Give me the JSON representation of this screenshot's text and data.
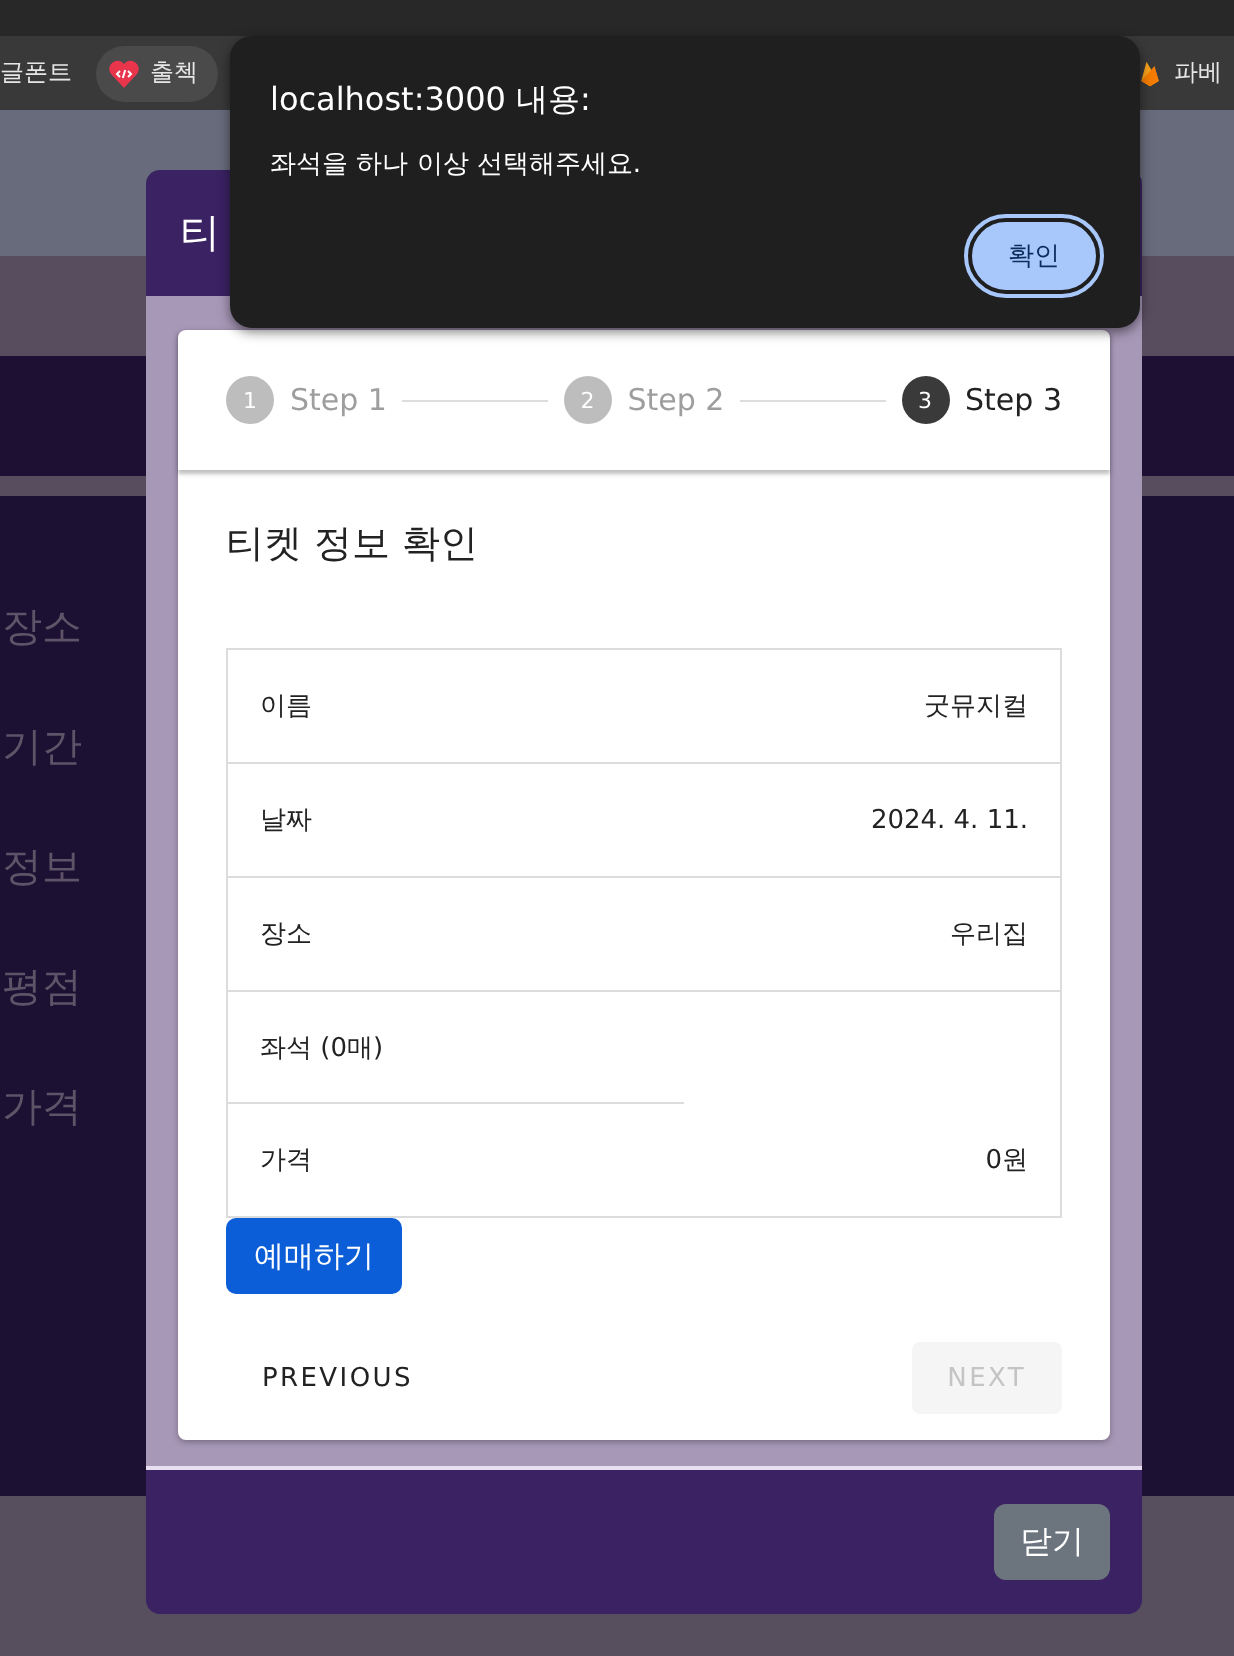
{
  "bookmarks": [
    {
      "label": "글폰트",
      "kind": "plain"
    },
    {
      "label": "출첵",
      "kind": "chip"
    },
    {
      "label": "파베",
      "kind": "flame"
    }
  ],
  "background": {
    "side_labels": [
      "장소",
      "기간",
      "정보",
      "평점",
      "가격"
    ]
  },
  "modal": {
    "title": "티",
    "steps": [
      {
        "number": "1",
        "label": "Step 1",
        "selected": false
      },
      {
        "number": "2",
        "label": "Step 2",
        "selected": false
      },
      {
        "number": "3",
        "label": "Step 3",
        "selected": true
      }
    ],
    "section_title": "티켓 정보 확인",
    "rows": [
      {
        "label": "이름",
        "value": "굿뮤지컬"
      },
      {
        "label": "날짜",
        "value": "2024. 4. 11."
      },
      {
        "label": "장소",
        "value": "우리집"
      },
      {
        "label": "좌석 (0매)"
      },
      {
        "label": "가격",
        "value": "0원"
      }
    ],
    "book_button": "예매하기",
    "previous_button": {
      "label": "PREVIOUS",
      "disabled": false
    },
    "next_button": {
      "label": "NEXT",
      "disabled": true
    },
    "close_button": "닫기"
  },
  "alert": {
    "title": "localhost:3000 내용:",
    "message": "좌석을 하나 이상 선택해주세요.",
    "ok_button": "확인"
  }
}
